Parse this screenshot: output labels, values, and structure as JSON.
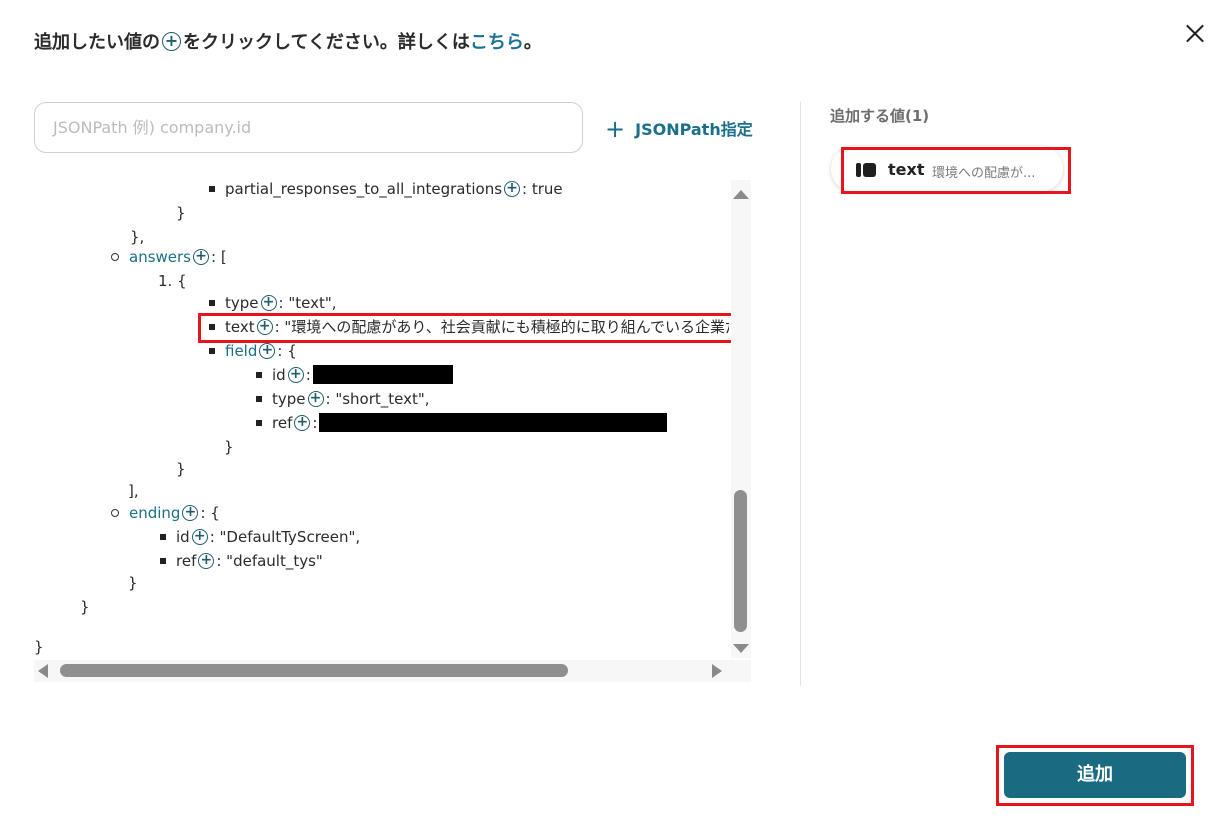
{
  "header": {
    "text_before": "追加したい値の",
    "plus_glyph": "+",
    "text_middle": "をクリックしてください。詳しくは",
    "link_text": "こちら",
    "text_after": "。"
  },
  "search": {
    "placeholder": "JSONPath  例) company.id"
  },
  "jsonpath_button": {
    "icon": "+",
    "label": "JSONPath指定"
  },
  "tree": {
    "l1_key": "partial_responses_to_all_integrations",
    "l1_sep": ": ",
    "l1_val": "true",
    "l2": "}",
    "l3": "},",
    "l4_key": "answers",
    "l4_rest": ": [",
    "l5": "1. {",
    "l6_key": "type",
    "l6_rest": ": \"text\",",
    "l7_key": "text",
    "l7_rest": ": \"環境への配慮があり、社会貢献にも積極的に取り組んでいる企業だ",
    "l8_key": "field",
    "l8_rest": ": {",
    "l9_key": "id",
    "l9_rest": ":",
    "l10_key": "type",
    "l10_rest": ": \"short_text\",",
    "l11_key": "ref",
    "l11_rest": ":",
    "l12": "}",
    "l13": "}",
    "l14": "],",
    "l15_key": "ending",
    "l15_rest": ": {",
    "l16_key": "id",
    "l16_rest": ": \"DefaultTyScreen\",",
    "l17_key": "ref",
    "l17_rest": ": \"default_tys\"",
    "l18": "}",
    "l19": "}",
    "l20": "}"
  },
  "right_panel": {
    "title": "追加する値(1)",
    "chip_label": "text",
    "chip_preview": "環境への配慮が..."
  },
  "add_button": {
    "label": "追加"
  },
  "colors": {
    "accent": "#1a6a82",
    "link": "#1a7191",
    "highlight": "#e8141c"
  }
}
